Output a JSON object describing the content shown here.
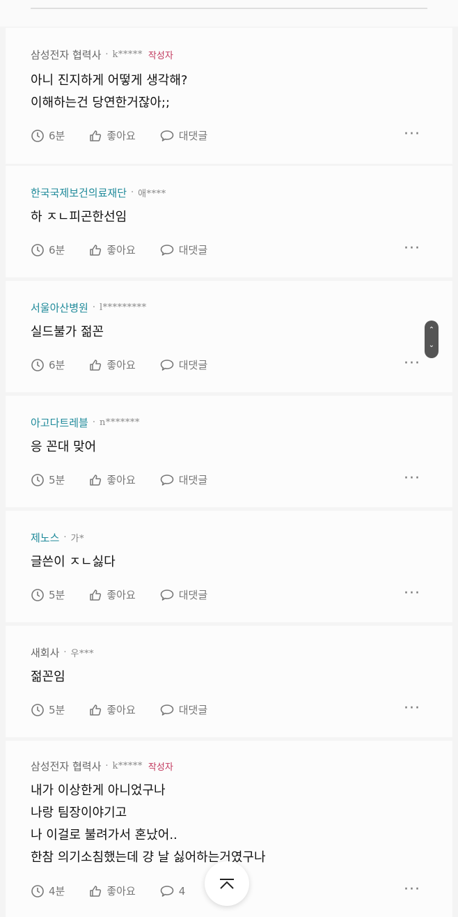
{
  "comments": [
    {
      "company": "삼성전자 협력사",
      "user": "k*****",
      "author_badge": "작성자",
      "lines": [
        "아니 진지하게 어떻게 생각해?",
        "이해하는건 당연한거잖아;;"
      ],
      "time": "6분",
      "like_label": "좋아요",
      "reply_label": "대댓글"
    },
    {
      "company": "한국국제보건의료재단",
      "user": "애****",
      "lines": [
        "하 ㅈㄴ피곤한선임"
      ],
      "time": "6분",
      "like_label": "좋아요",
      "reply_label": "대댓글"
    },
    {
      "company": "서울아산병원",
      "user": "l*********",
      "lines": [
        "실드불가 젊꼰"
      ],
      "time": "6분",
      "like_label": "좋아요",
      "reply_label": "대댓글"
    },
    {
      "company": "아고다트레블",
      "user": "n*******",
      "lines": [
        "응 꼰대 맞어"
      ],
      "time": "5분",
      "like_label": "좋아요",
      "reply_label": "대댓글"
    },
    {
      "company": "제노스",
      "user": "가*",
      "lines": [
        "글쓴이 ㅈㄴ싫다"
      ],
      "time": "5분",
      "like_label": "좋아요",
      "reply_label": "대댓글"
    },
    {
      "company": "새회사",
      "user": "우***",
      "lines": [
        "젊꼰임"
      ],
      "time": "5분",
      "like_label": "좋아요",
      "reply_label": "대댓글"
    },
    {
      "company": "삼성전자 협력사",
      "user": "k*****",
      "author_badge": "작성자",
      "lines": [
        "내가 이상한게 아니었구나",
        "나랑 팀장이야기고",
        "나 이걸로 불려가서 혼났어..",
        "한참 의기소침했는데 걍 날 싫어하는거였구나"
      ],
      "time": "4분",
      "like_label": "좋아요",
      "reply_count": "4"
    }
  ],
  "colors": {
    "teal": "#1f8a9a",
    "author_badge": "#c2395e"
  },
  "icons": [
    "clock-icon",
    "thumbs-up-icon",
    "speech-bubble-icon",
    "more-icon",
    "chevron-up-icon"
  ]
}
